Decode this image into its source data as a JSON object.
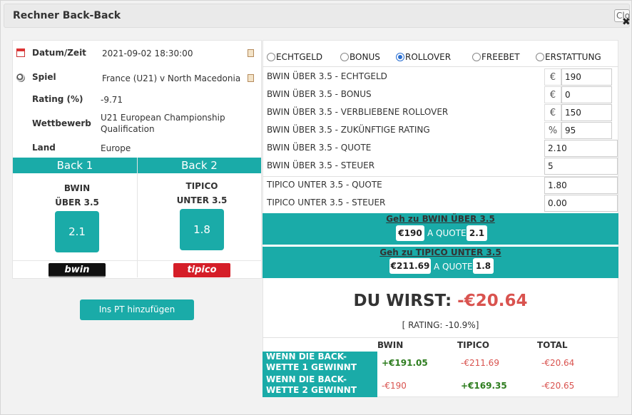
{
  "window": {
    "title": "Rechner Back-Back",
    "close_label": "Close"
  },
  "info": {
    "date_label": "Datum/Zeit",
    "date_value": "2021-09-02 18:30:00",
    "match_label": "Spiel",
    "match_value": "France (U21) v North Macedonia (U",
    "rating_label": "Rating (%)",
    "rating_value": "-9.71",
    "competition_label": "Wettbewerb",
    "competition_value": "U21 European Championship Qualification",
    "country_label": "Land",
    "country_value": "Europe"
  },
  "back1": {
    "header": "Back 1",
    "book": "BWIN",
    "market": "ÜBER 3.5",
    "odds": "2.1",
    "logo": "bwin"
  },
  "back2": {
    "header": "Back 2",
    "book": "TIPICO",
    "market": "UNTER 3.5",
    "odds": "1.8",
    "logo": "tipico"
  },
  "add_button": "Ins PT hinzufügen",
  "mode": {
    "options": [
      "ECHTGELD",
      "BONUS",
      "ROLLOVER",
      "FREEBET",
      "ERSTATTUNG"
    ],
    "selected": "ROLLOVER"
  },
  "fields": {
    "real_money": {
      "label": "BWIN ÜBER 3.5 - ECHTGELD",
      "unit": "€",
      "value": "190"
    },
    "bonus": {
      "label": "BWIN ÜBER 3.5 - BONUS",
      "unit": "€",
      "value": "0"
    },
    "rollover": {
      "label": "BWIN ÜBER 3.5 - VERBLIEBENE ROLLOVER",
      "unit": "€",
      "value": "150"
    },
    "future_rating": {
      "label": "BWIN ÜBER 3.5 - ZUKÜNFTIGE RATING",
      "unit": "%",
      "value": "95"
    },
    "quote1": {
      "label": "BWIN ÜBER 3.5 - QUOTE",
      "value": "2.10"
    },
    "tax1": {
      "label": "BWIN ÜBER 3.5 - STEUER",
      "value": "5"
    },
    "quote2": {
      "label": "TIPICO UNTER 3.5  - QUOTE",
      "value": "1.80"
    },
    "tax2": {
      "label": "TIPICO UNTER 3.5 - STEUER",
      "value": "0.00"
    }
  },
  "go1": {
    "link": "Geh zu BWIN ÜBER 3.5",
    "stake": "€190",
    "at": "A QUOTE",
    "odds": "2.1"
  },
  "go2": {
    "link": "Geh zu TIPICO UNTER 3.5",
    "stake": "€211.69",
    "at": "A QUOTE",
    "odds": "1.8"
  },
  "result": {
    "prefix": "DU WIRST:",
    "amount": "-€20.64",
    "rating": "[ RATING: -10.9%]"
  },
  "table": {
    "headers": [
      "BWIN",
      "TIPICO",
      "TOTAL"
    ],
    "rows": [
      {
        "label": "WENN DIE BACK-WETTE 1 GEWINNT",
        "bwin": "+€191.05",
        "tipico": "-€211.69",
        "total": "-€20.64"
      },
      {
        "label": "WENN DIE BACK-WETTE 2 GEWINNT",
        "bwin": "-€190",
        "tipico": "+€169.35",
        "total": "-€20.65"
      }
    ]
  },
  "colors": {
    "accent": "#1aaba8",
    "negative": "#d9534f",
    "positive": "#2e7d1f"
  }
}
